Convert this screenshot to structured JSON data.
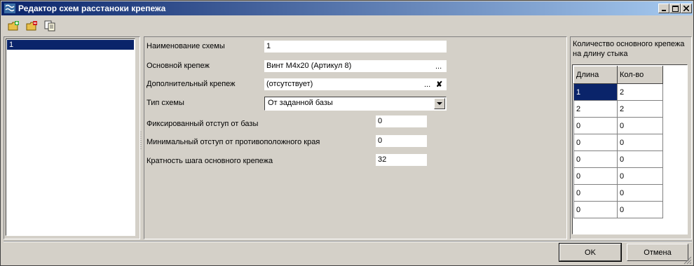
{
  "window": {
    "title": "Редактор схем расстаноки крепежа"
  },
  "toolbar": {
    "icons": [
      "add-scheme-icon",
      "delete-scheme-icon",
      "copy-scheme-icon"
    ]
  },
  "schemes_list": {
    "items": [
      "1"
    ],
    "selected": "1"
  },
  "form": {
    "name_label": "Наименование схемы",
    "name_value": "1",
    "main_fastener_label": "Основной крепеж",
    "main_fastener_value": "Винт M4x20 (Артикул 8)",
    "extra_fastener_label": "Дополнительный крепеж",
    "extra_fastener_value": "(отсутствует)",
    "ellipsis": "...",
    "clear_symbol": "✘",
    "scheme_type_label": "Тип схемы",
    "scheme_type_value": "От заданной базы",
    "fixed_offset_label": "Фиксированный отступ от базы",
    "fixed_offset_value": "0",
    "min_offset_label": "Минимальный отступ от противоположного края",
    "min_offset_value": "0",
    "step_multiple_label": "Кратность шага основного крепежа",
    "step_multiple_value": "32"
  },
  "right_panel": {
    "caption_line1": "Количество основного крепежа",
    "caption_line2": "на длину стыка",
    "columns": [
      "Длина",
      "Кол-во"
    ],
    "rows": [
      [
        "1",
        "2"
      ],
      [
        "2",
        "2"
      ],
      [
        "0",
        "0"
      ],
      [
        "0",
        "0"
      ],
      [
        "0",
        "0"
      ],
      [
        "0",
        "0"
      ],
      [
        "0",
        "0"
      ],
      [
        "0",
        "0"
      ]
    ]
  },
  "buttons": {
    "ok": "OK",
    "cancel": "Отмена"
  },
  "colors": {
    "title_start": "#0a246a",
    "title_end": "#a6caf0",
    "selection": "#0a246a",
    "face": "#d4d0c8"
  }
}
